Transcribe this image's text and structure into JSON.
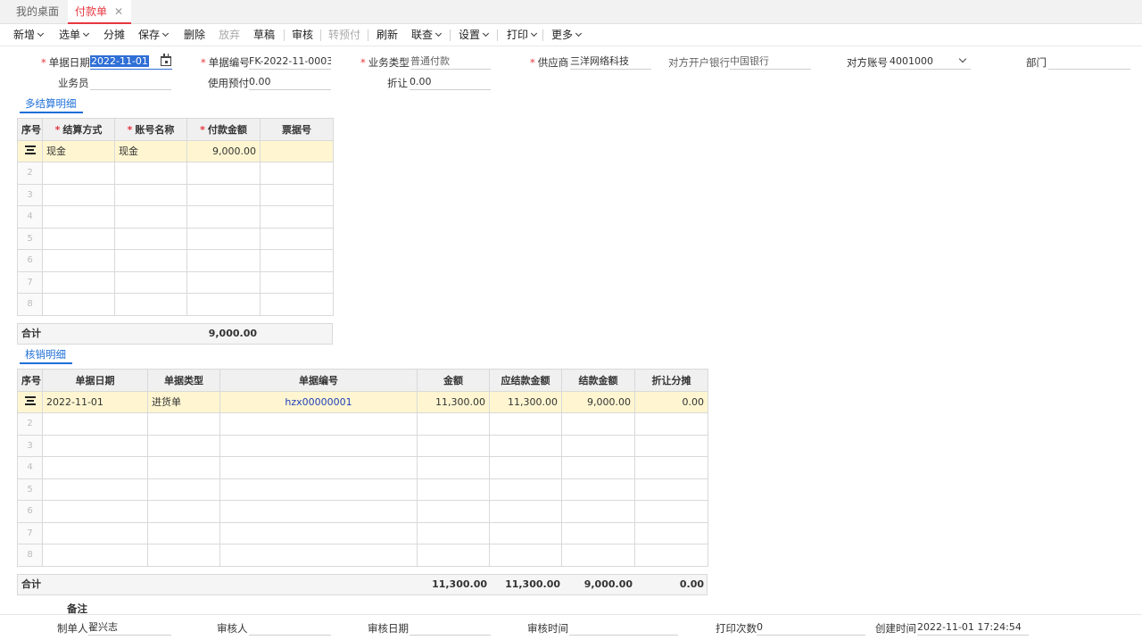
{
  "tabs": {
    "home": "我的桌面",
    "active": "付款单",
    "close": "✕"
  },
  "toolbar": {
    "new": "新增",
    "select": "选单",
    "split": "分摊",
    "save": "保存",
    "delete": "删除",
    "abandon": "放弃",
    "draft": "草稿",
    "audit": "审核",
    "to_prepay": "转预付",
    "refresh": "刷新",
    "link_query": "联查",
    "settings": "设置",
    "print": "打印",
    "more": "更多"
  },
  "form": {
    "date_label": "单据日期",
    "date_value": "2022-11-01",
    "docno_label": "单据编号",
    "docno_value": "FK-2022-11-0003",
    "biztype_label": "业务类型",
    "biztype_value": "普通付款",
    "supplier_label": "供应商",
    "supplier_value": "三洋网络科技",
    "bank_label": "对方开户银行",
    "bank_value": "中国银行",
    "account_label": "对方账号",
    "account_value": "4001000",
    "dept_label": "部门",
    "dept_value": "",
    "clerk_label": "业务员",
    "clerk_value": "",
    "prepay_label": "使用预付",
    "prepay_value": "0.00",
    "discount_label": "折让",
    "discount_value": "0.00"
  },
  "settlement": {
    "title": "多结算明细",
    "headers": [
      "序号",
      "结算方式",
      "账号名称",
      "付款金额",
      "票据号"
    ],
    "rows": [
      [
        "",
        "现金",
        "现金",
        "9,000.00",
        ""
      ],
      [
        "2",
        "",
        "",
        "",
        ""
      ],
      [
        "3",
        "",
        "",
        "",
        ""
      ],
      [
        "4",
        "",
        "",
        "",
        ""
      ],
      [
        "5",
        "",
        "",
        "",
        ""
      ],
      [
        "6",
        "",
        "",
        "",
        ""
      ],
      [
        "7",
        "",
        "",
        "",
        ""
      ],
      [
        "8",
        "",
        "",
        "",
        ""
      ]
    ],
    "total_label": "合计",
    "total_amount": "9,000.00"
  },
  "writeoff": {
    "title": "核销明细",
    "headers": [
      "序号",
      "单据日期",
      "单据类型",
      "单据编号",
      "金额",
      "应结款金额",
      "结款金额",
      "折让分摊"
    ],
    "rows": [
      [
        "",
        "2022-11-01",
        "进货单",
        "hzx00000001",
        "11,300.00",
        "11,300.00",
        "9,000.00",
        "0.00"
      ],
      [
        "2",
        "",
        "",
        "",
        "",
        "",
        "",
        ""
      ],
      [
        "3",
        "",
        "",
        "",
        "",
        "",
        "",
        ""
      ],
      [
        "4",
        "",
        "",
        "",
        "",
        "",
        "",
        ""
      ],
      [
        "5",
        "",
        "",
        "",
        "",
        "",
        "",
        ""
      ],
      [
        "6",
        "",
        "",
        "",
        "",
        "",
        "",
        ""
      ],
      [
        "7",
        "",
        "",
        "",
        "",
        "",
        "",
        ""
      ],
      [
        "8",
        "",
        "",
        "",
        "",
        "",
        "",
        ""
      ]
    ],
    "total_label": "合计",
    "total_amount": "11,300.00",
    "total_due": "11,300.00",
    "total_paid": "9,000.00",
    "total_discount": "0.00"
  },
  "footer": {
    "remark_label": "备注",
    "maker_label": "制单人",
    "maker_value": "翟兴志",
    "auditor_label": "审核人",
    "auditor_value": "",
    "audit_date_label": "审核日期",
    "audit_date_value": "",
    "audit_time_label": "审核时间",
    "audit_time_value": "",
    "print_count_label": "打印次数",
    "print_count_value": "0",
    "created_label": "创建时间",
    "created_value": "2022-11-01 17:24:54"
  }
}
